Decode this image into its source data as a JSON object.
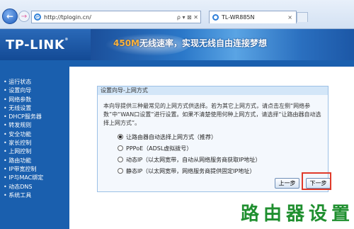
{
  "browser": {
    "address_url": "http://tplogin.cn/",
    "address_controls": "ρ ▾ ⊠ ✕",
    "tab_title": "TL-WR885N",
    "tab_close": "×"
  },
  "header": {
    "logo": "TP-LINK",
    "logo_mark": "®",
    "slogan_speed": "450M",
    "slogan_text": "无线速率，实现无线自由连接梦想"
  },
  "menu": [
    "运行状态",
    "设置向导",
    "网络参数",
    "无线设置",
    "DHCP服务器",
    "转发规则",
    "安全功能",
    "家长控制",
    "上网控制",
    "路由功能",
    "IP带宽控制",
    "IP与MAC绑定",
    "动态DNS",
    "系统工具"
  ],
  "panel": {
    "title": "设置向导-上网方式",
    "description": "本向导提供三种最常见的上网方式供选择。若为其它上网方式，请点击左侧“网络参数”中“WAN口设置”进行设置。如果不清楚使用何种上网方式，请选择“让路由器自动选择上网方式”。",
    "options": [
      {
        "label": "让路由器自动选择上网方式（推荐）",
        "selected": true
      },
      {
        "label": "PPPoE（ADSL虚拟拨号）",
        "selected": false
      },
      {
        "label": "动态IP（以太网宽带，自动从网络服务商获取IP地址）",
        "selected": false
      },
      {
        "label": "静态IP（以太网宽带，网络服务商提供固定IP地址）",
        "selected": false
      }
    ],
    "prev_button": "上一步",
    "next_button": "下一步"
  },
  "watermark": "路由器设置",
  "colors": {
    "menu_bg": "#1a5fae",
    "highlight": "#e03a2a",
    "watermark": "#1f8f2f"
  }
}
